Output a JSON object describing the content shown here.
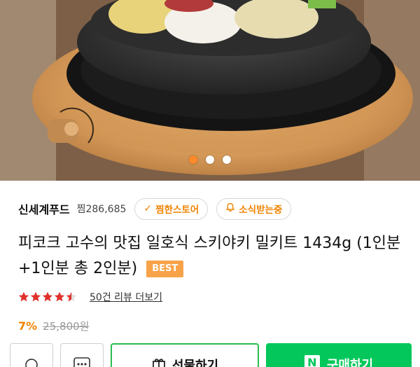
{
  "carousel": {
    "count": 3,
    "active_index": 0
  },
  "store": {
    "name": "신세계푸드",
    "jjim_count": "찜286,685",
    "jjim_store_label": "찜한스토어",
    "notify_label": "소식받는중"
  },
  "product": {
    "title": "피코크 고수의 맛집 일호식 스키야키 밀키트 1434g (1인분+1인분 총 2인분)",
    "badge": "BEST",
    "rating": 4.5,
    "review_link": "50건 리뷰 더보기",
    "discount": "7%",
    "original_price": "25,800원"
  },
  "bottom_bar": {
    "gift_label": "선물하기",
    "buy_label": "구매하기",
    "naver_mark": "N"
  },
  "colors": {
    "accent": "#f08300",
    "dot_active": "#ff8a2a",
    "best_badge": "#f8a349",
    "buy_green": "#03c75a",
    "star": "#e0312d"
  },
  "icons": {
    "like": "chat-heart-icon",
    "more": "more-dots-icon",
    "gift": "gift-icon",
    "check": "check-icon",
    "bell": "bell-icon"
  }
}
